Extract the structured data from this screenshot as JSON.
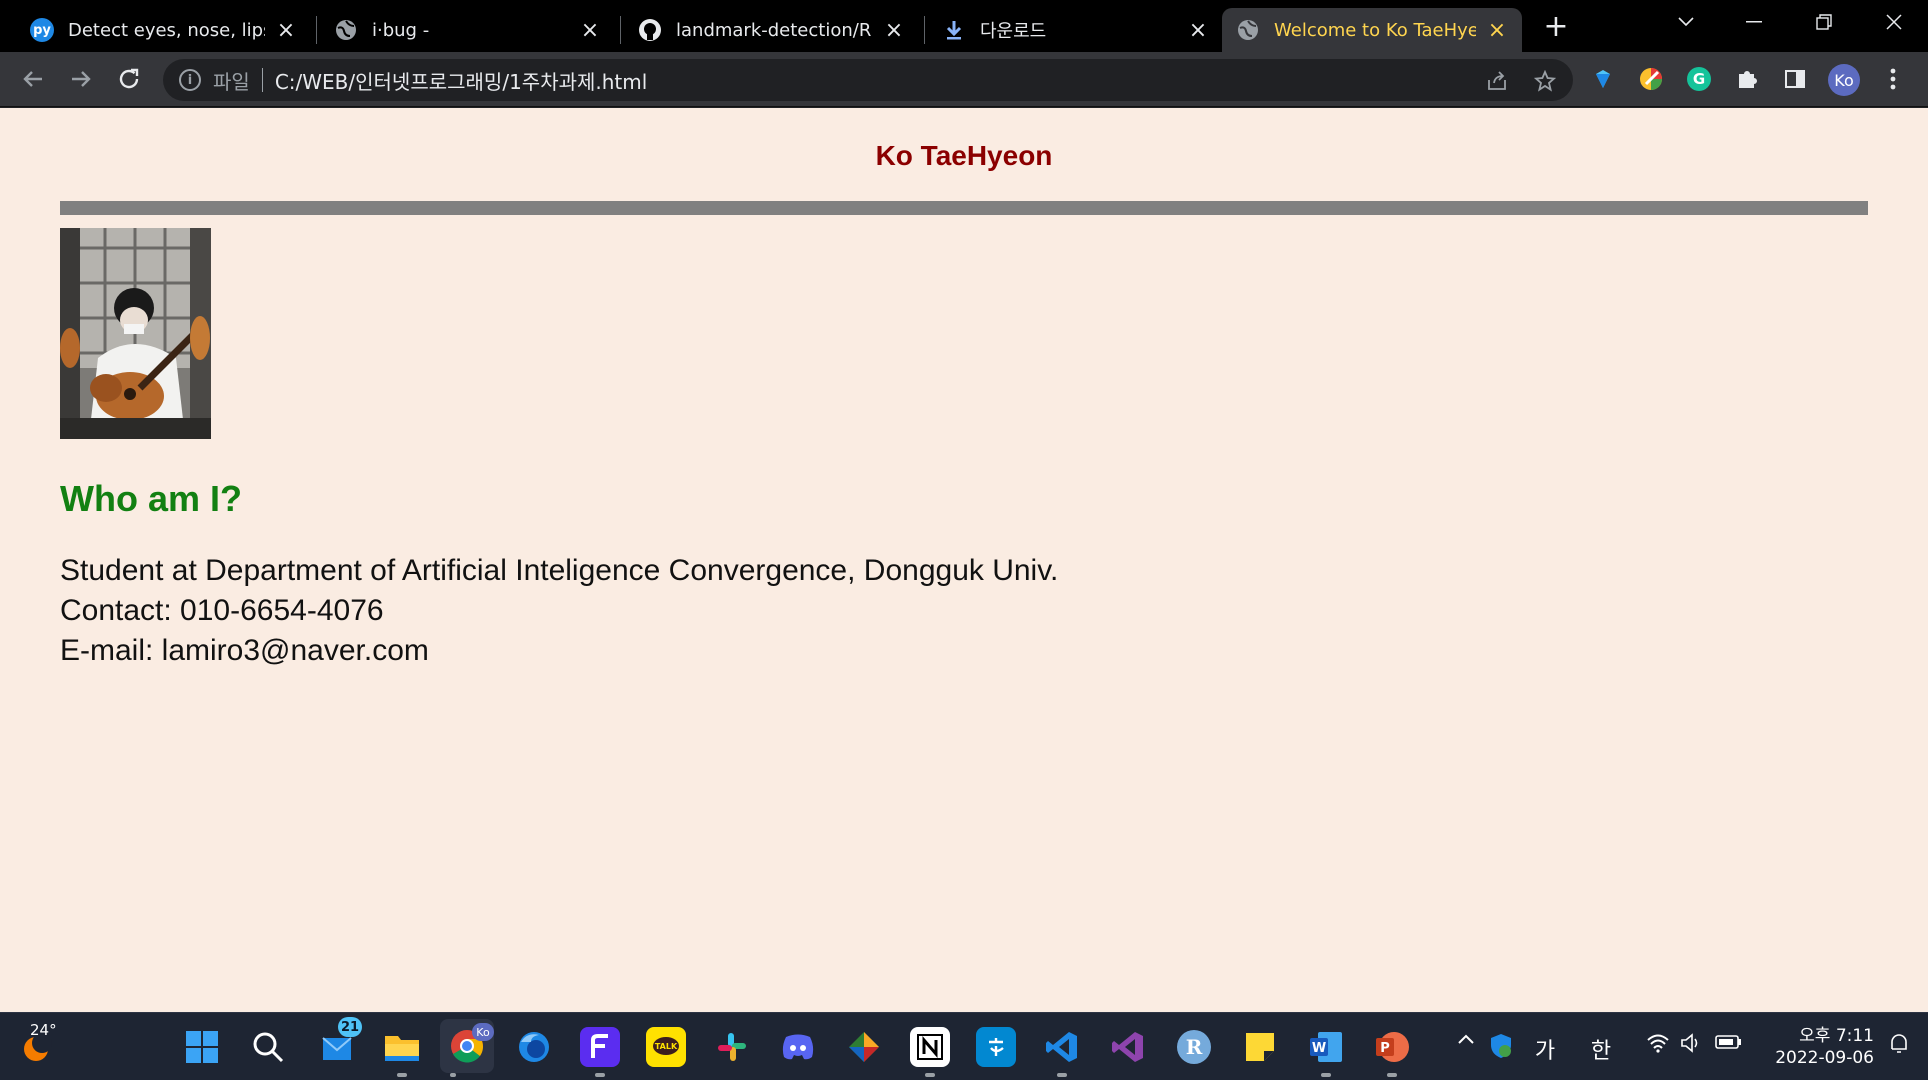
{
  "tabs": [
    {
      "title": "Detect eyes, nose, lips, and jaw",
      "favicon": "pyimagesearch-icon",
      "favicon_letter": "py",
      "favicon_color": "#1e88e5"
    },
    {
      "title": "i·bug -",
      "favicon": "globe-icon"
    },
    {
      "title": "landmark-detection/README.md",
      "favicon": "github-icon"
    },
    {
      "title": "다운로드",
      "favicon": "download-icon"
    },
    {
      "title": "Welcome to Ko TaeHyeon",
      "favicon": "globe-icon",
      "active": true
    }
  ],
  "omnibox": {
    "scheme_label": "파일",
    "url": "C:/WEB/인터넷프로그래밍/1주차과제.html"
  },
  "profile": {
    "initials": "Ko"
  },
  "page": {
    "title": "Ko TaeHyeon",
    "heading": "Who am I?",
    "lines": [
      "Student at Department of Artificial Inteligence Convergence, Dongguk Univ.",
      "Contact: 010-6654-4076",
      "E-mail: lamiro3@naver.com"
    ]
  },
  "taskbar": {
    "weather_temp": "24°",
    "mail_badge": "21",
    "chrome_badge": "Ko",
    "ime_ga": "가",
    "ime_han": "한",
    "clock_time": "오후 7:11",
    "clock_date": "2022-09-06"
  },
  "colors": {
    "page_bg": "#faece2",
    "title_color": "#8b0000",
    "heading_color": "#128012",
    "rule_color": "#808080",
    "active_tab_text": "#ffd54f"
  }
}
